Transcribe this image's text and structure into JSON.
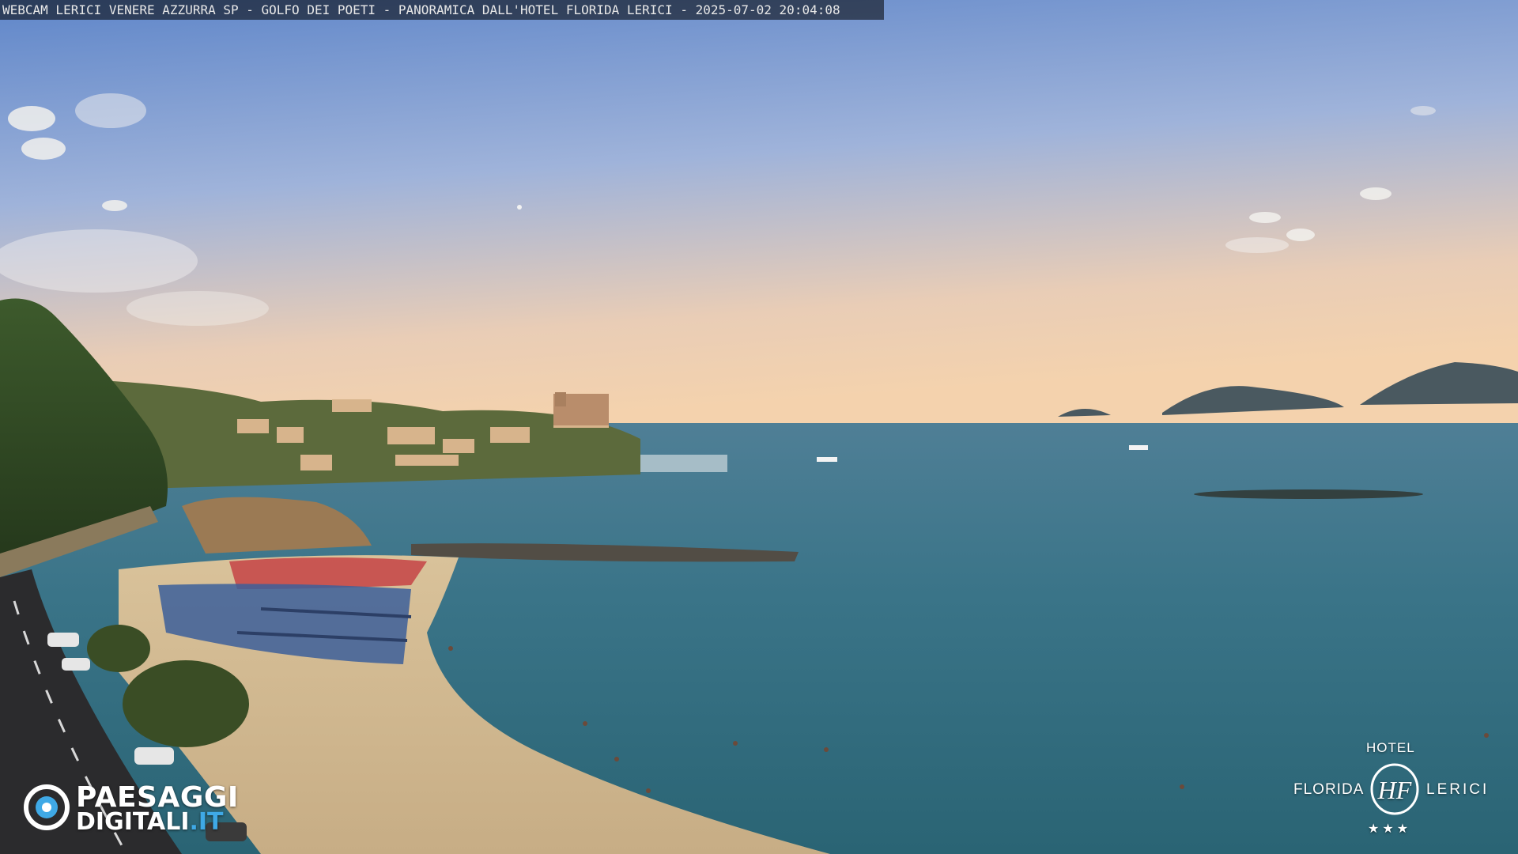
{
  "overlay": {
    "caption": "WEBCAM LERICI VENERE AZZURRA SP - GOLFO DEI POETI - PANORAMICA DALL'HOTEL FLORIDA LERICI - 2025-07-02 20:04:08"
  },
  "watermark": {
    "brand_line1": "PAESAGGI",
    "brand_line2": "DIGITALI",
    "brand_tld": ".IT"
  },
  "hotel_logo": {
    "top": "HOTEL",
    "left": "FLORIDA",
    "right": "LERICI",
    "monogram": "HF",
    "stars": "★★★"
  },
  "colors": {
    "sky_top": "#6a8cc8",
    "sky_horizon": "#f2d2b0",
    "sea": "#2f6f80",
    "sand": "#d8c29c",
    "brand_accent": "#3fa9e6"
  }
}
